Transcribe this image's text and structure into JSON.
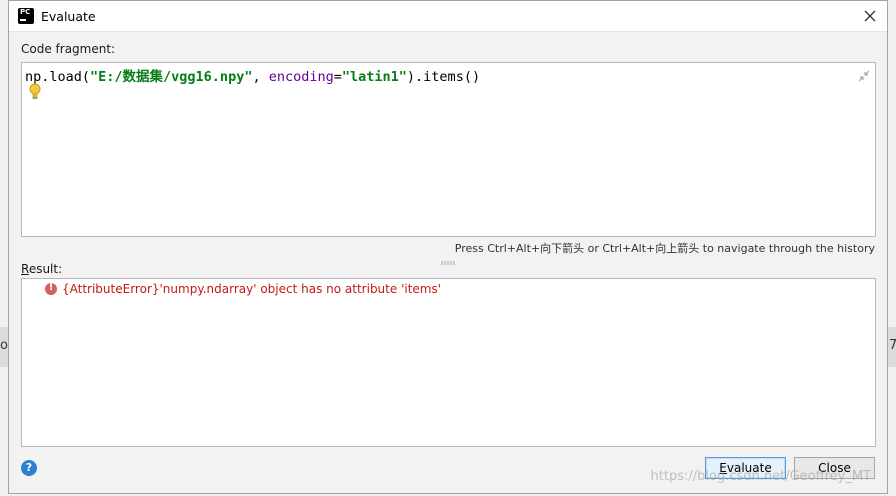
{
  "background": {
    "left_glyph": "o",
    "right_glyph": "7"
  },
  "window": {
    "title": "Evaluate",
    "app_icon_text": "PC"
  },
  "code_fragment": {
    "label": "Code fragment:",
    "tokens": {
      "prefix": "np.load(",
      "path": "\"E:/数据集/vgg16.npy\"",
      "sep": ", ",
      "param": "encoding",
      "eq": "=",
      "enc": "\"latin1\"",
      "suffix": ").items()"
    }
  },
  "history_hint": "Press Ctrl+Alt+向下箭头 or Ctrl+Alt+向上箭头 to navigate through the history",
  "result": {
    "label_underlined": "R",
    "label_rest": "esult:",
    "error_text": "{AttributeError}'numpy.ndarray' object has no attribute 'items'"
  },
  "buttons": {
    "help": "?",
    "evaluate_mnemonic": "E",
    "evaluate_rest": "valuate",
    "close": "Close"
  },
  "watermark": "https://blog.csdn.net/Geoffrey_MT",
  "colors": {
    "error": "#c41a16",
    "string": "#067d17",
    "keyword_param": "#660099",
    "primary_border": "#5a9bd8"
  }
}
